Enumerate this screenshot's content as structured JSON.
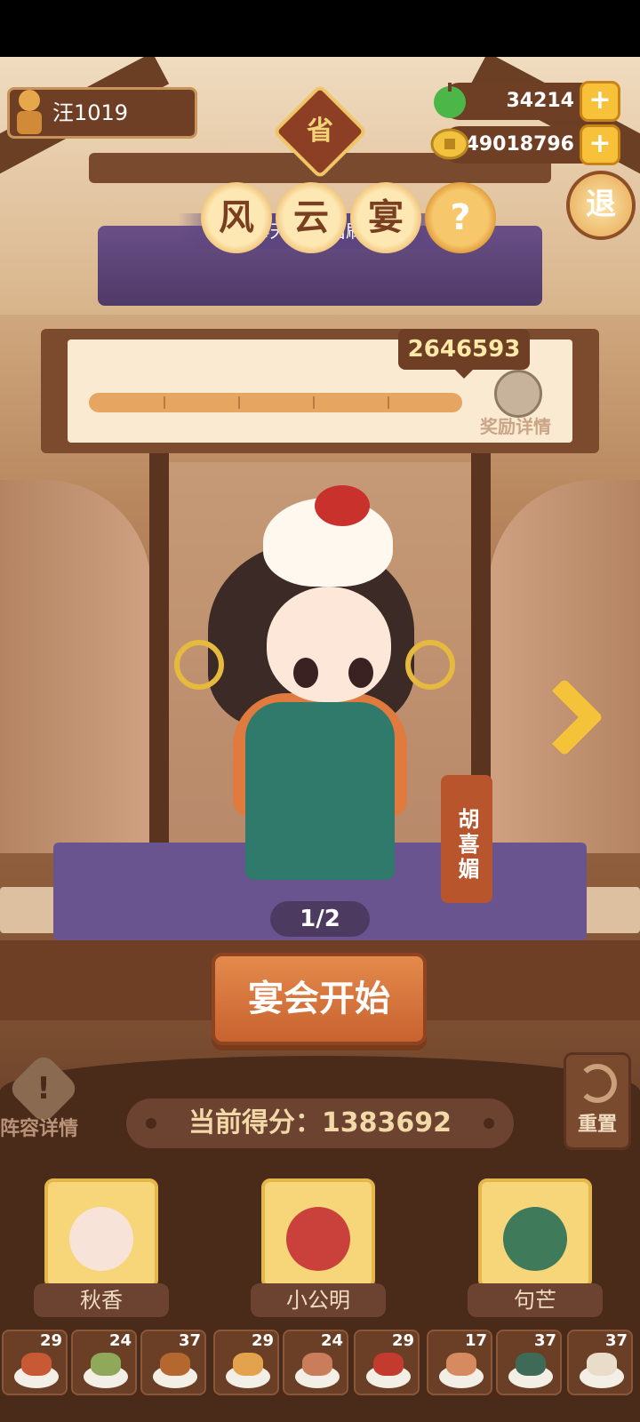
{
  "player": {
    "name": "汪1019"
  },
  "currency": {
    "apples": "34214",
    "coins": "49018796",
    "plus": "+"
  },
  "province_label": "省",
  "exit_label": "退",
  "event": {
    "title_chars": [
      "风",
      "云",
      "宴"
    ],
    "help": "?",
    "refresh_text": "4天22时后刷新"
  },
  "score_board": {
    "total_score": "2646593",
    "reward_details": "奖励详情",
    "progress": 1.0
  },
  "character": {
    "name": "胡喜媚",
    "page": "1/2"
  },
  "start_button": "宴会开始",
  "lineup_details": "阵容详情",
  "reset_label": "重置",
  "current_score": {
    "label": "当前得分：",
    "value": "1383692"
  },
  "team": [
    {
      "name": "秋香",
      "color": "#f7e3d8"
    },
    {
      "name": "小公明",
      "color": "#c9413a"
    },
    {
      "name": "句芒",
      "color": "#3f7a5a"
    }
  ],
  "dishes": [
    {
      "count": "29",
      "color": "#c75a35"
    },
    {
      "count": "24",
      "color": "#8fa85a"
    },
    {
      "count": "37",
      "color": "#b4672e"
    },
    {
      "count": "29",
      "color": "#e3a34c"
    },
    {
      "count": "24",
      "color": "#c97d5a"
    },
    {
      "count": "29",
      "color": "#c33a2f"
    },
    {
      "count": "17",
      "color": "#d58a60"
    },
    {
      "count": "37",
      "color": "#3f6a58"
    },
    {
      "count": "37",
      "color": "#e9ddc9"
    }
  ],
  "colors": {
    "accent": "#f5c33a",
    "wood": "#6e3f25",
    "stage": "#6a5490"
  }
}
